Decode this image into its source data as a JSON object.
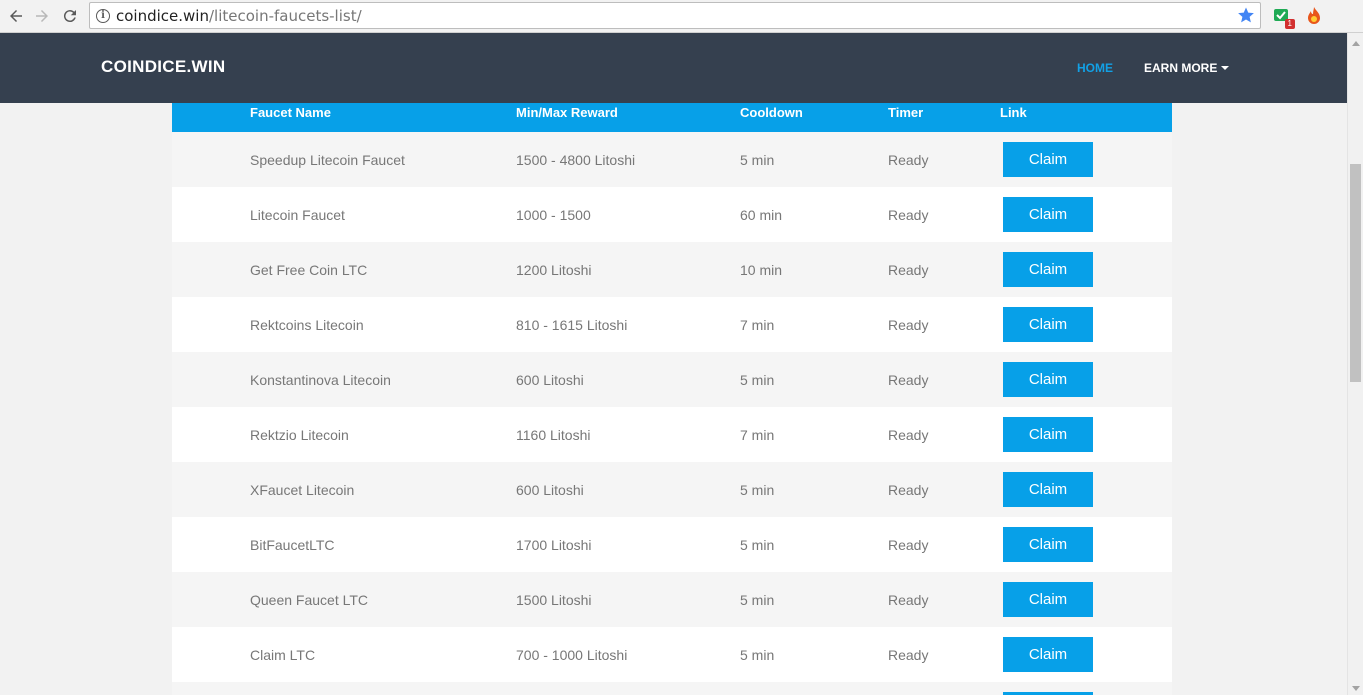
{
  "browser": {
    "url_host": "coindice.win",
    "url_path": "/litecoin-faucets-list/",
    "extension_badge": "1"
  },
  "header": {
    "brand": "COINDICE.WIN",
    "nav_home": "HOME",
    "nav_earn_more": "EARN MORE"
  },
  "table": {
    "columns": [
      "Faucet Name",
      "Min/Max Reward",
      "Cooldown",
      "Timer",
      "Link"
    ],
    "rows": [
      {
        "name": "Speedup Litecoin Faucet",
        "reward": "1500 - 4800 Litoshi",
        "cooldown": "5 min",
        "timer": "Ready",
        "link": "Claim"
      },
      {
        "name": "Litecoin Faucet",
        "reward": "1000 - 1500",
        "cooldown": "60 min",
        "timer": "Ready",
        "link": "Claim"
      },
      {
        "name": "Get Free Coin LTC",
        "reward": "1200 Litoshi",
        "cooldown": "10 min",
        "timer": "Ready",
        "link": "Claim"
      },
      {
        "name": "Rektcoins Litecoin",
        "reward": "810 - 1615 Litoshi",
        "cooldown": "7 min",
        "timer": "Ready",
        "link": "Claim"
      },
      {
        "name": "Konstantinova Litecoin",
        "reward": "600 Litoshi",
        "cooldown": "5 min",
        "timer": "Ready",
        "link": "Claim"
      },
      {
        "name": "Rektzio Litecoin",
        "reward": "1160 Litoshi",
        "cooldown": "7 min",
        "timer": "Ready",
        "link": "Claim"
      },
      {
        "name": "XFaucet Litecoin",
        "reward": "600 Litoshi",
        "cooldown": "5 min",
        "timer": "Ready",
        "link": "Claim"
      },
      {
        "name": "BitFaucetLTC",
        "reward": "1700 Litoshi",
        "cooldown": "5 min",
        "timer": "Ready",
        "link": "Claim"
      },
      {
        "name": "Queen Faucet LTC",
        "reward": "1500 Litoshi",
        "cooldown": "5 min",
        "timer": "Ready",
        "link": "Claim"
      },
      {
        "name": "Claim LTC",
        "reward": "700 - 1000 Litoshi",
        "cooldown": "5 min",
        "timer": "Ready",
        "link": "Claim"
      }
    ]
  },
  "colors": {
    "header_bg": "#35404f",
    "accent": "#07a0e8",
    "row_alt": "#f5f5f5",
    "text_muted": "#777777"
  }
}
